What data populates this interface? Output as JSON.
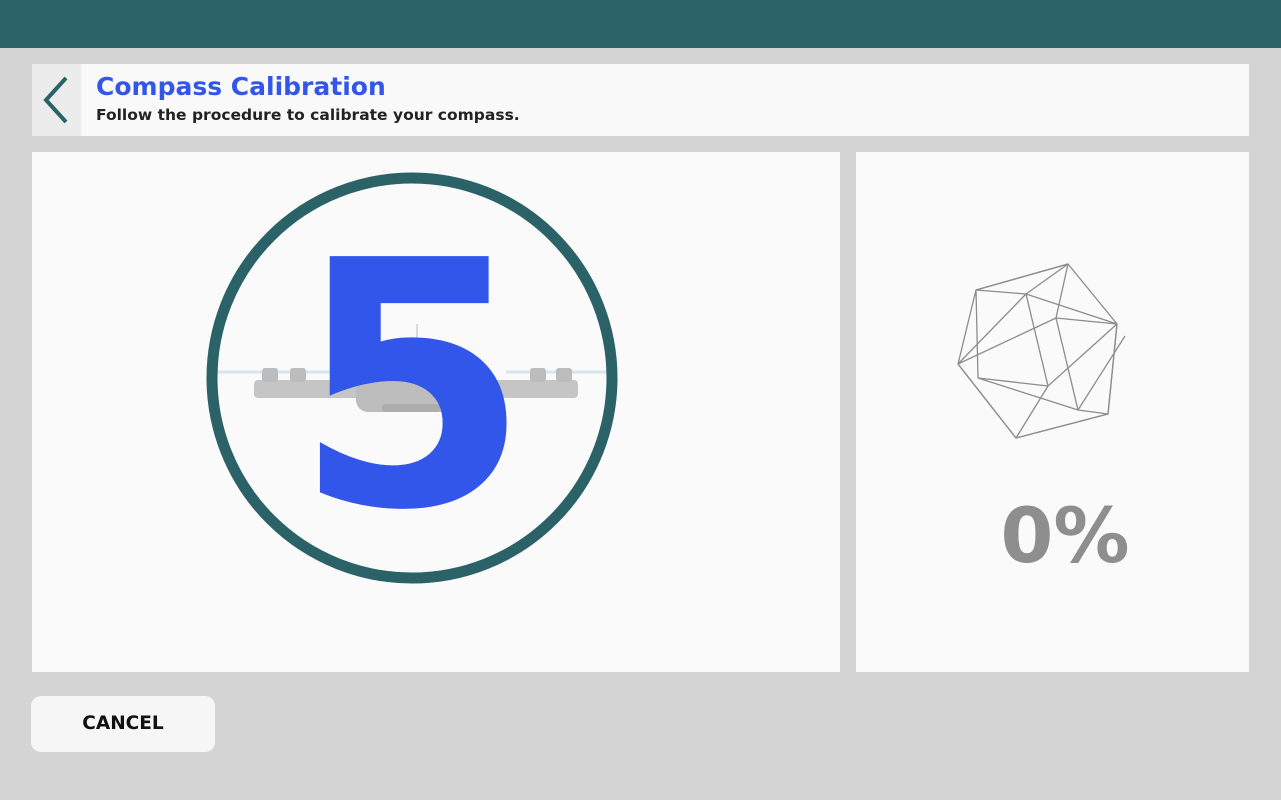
{
  "header": {
    "title": "Compass Calibration",
    "subtitle": "Follow the procedure to calibrate your compass."
  },
  "countdown": {
    "value": "5"
  },
  "progress": {
    "label": "0%",
    "value": 0
  },
  "footer": {
    "cancel_label": "CANCEL"
  },
  "icons": {
    "back": "chevron-left-icon",
    "drone": "drone-icon",
    "calibration_sphere": "wireframe-sphere-icon"
  },
  "colors": {
    "topbar": "#2b6268",
    "accent_title": "#3256ea",
    "countdown_digit": "#3256ea",
    "ring": "#2b6268",
    "progress_text": "#8e8e8e",
    "background": "#d4d4d4",
    "panel": "#fafafa"
  }
}
